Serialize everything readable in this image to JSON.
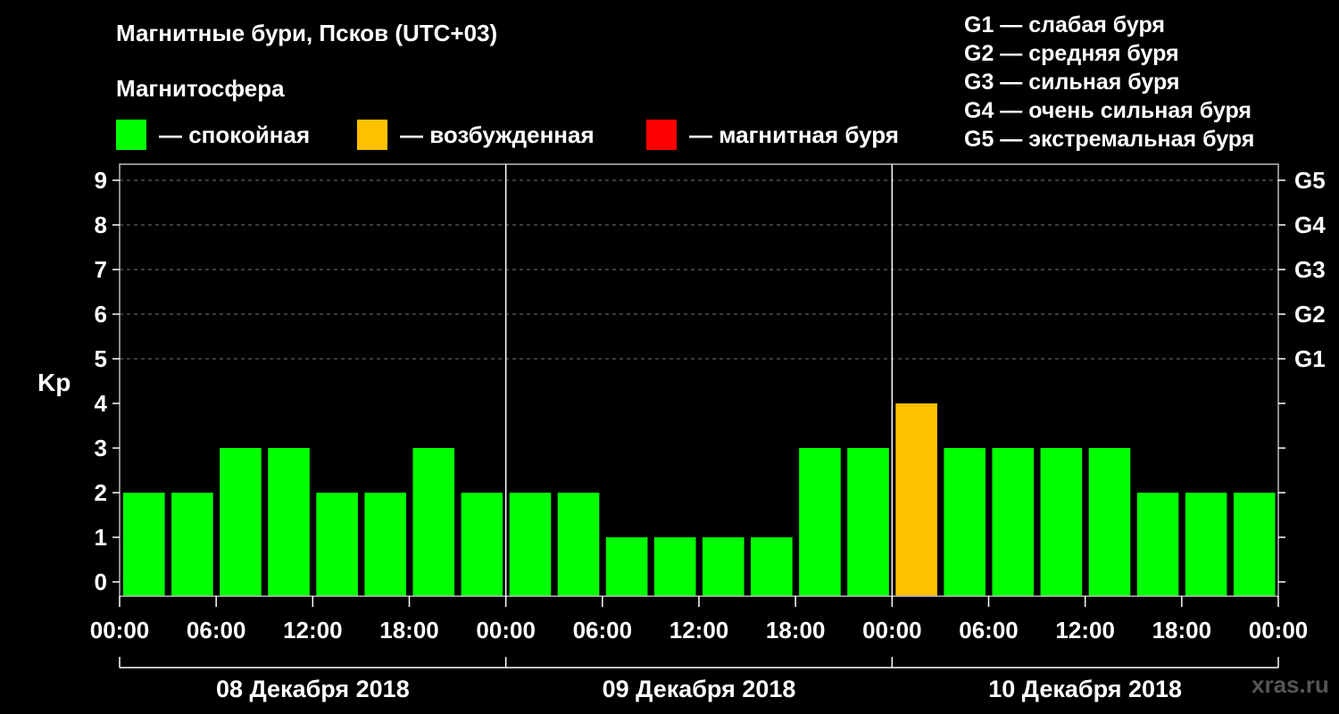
{
  "header": {
    "title": "Магнитные бури, Псков (UTC+03)",
    "subtitle": "Магнитосфера"
  },
  "legend": [
    {
      "label": "— спокойная",
      "color": "#00ff00"
    },
    {
      "label": "— возбужденная",
      "color": "#ffc000"
    },
    {
      "label": "— магнитная буря",
      "color": "#ff0000"
    }
  ],
  "g_legend": [
    "G1 — слабая буря",
    "G2 — средняя буря",
    "G3 — сильная буря",
    "G4 — очень сильная буря",
    "G5 — экстремальная буря"
  ],
  "watermark": "xras.ru",
  "chart_data": {
    "type": "bar",
    "ylabel": "Kp",
    "ylim": [
      0,
      9
    ],
    "y_ticks": [
      "0",
      "1",
      "2",
      "3",
      "4",
      "5",
      "6",
      "7",
      "8",
      "9"
    ],
    "right_ticks": [
      {
        "value": 5,
        "label": "G1"
      },
      {
        "value": 6,
        "label": "G2"
      },
      {
        "value": 7,
        "label": "G3"
      },
      {
        "value": 8,
        "label": "G4"
      },
      {
        "value": 9,
        "label": "G5"
      }
    ],
    "grid": "horizontal dashed at 5-9",
    "x_ticks": [
      "00:00",
      "06:00",
      "12:00",
      "18:00",
      "00:00",
      "06:00",
      "12:00",
      "18:00",
      "00:00",
      "06:00",
      "12:00",
      "18:00",
      "00:00"
    ],
    "days": [
      "08 Декабря 2018",
      "09 Декабря 2018",
      "10 Декабря 2018"
    ],
    "values": [
      2,
      2,
      3,
      3,
      2,
      2,
      3,
      2,
      2,
      2,
      1,
      1,
      1,
      1,
      3,
      3,
      4,
      3,
      3,
      3,
      3,
      2,
      2,
      2
    ],
    "colors": {
      "quiet": "#00ff00",
      "active": "#ffc000",
      "storm": "#ff0000"
    }
  }
}
